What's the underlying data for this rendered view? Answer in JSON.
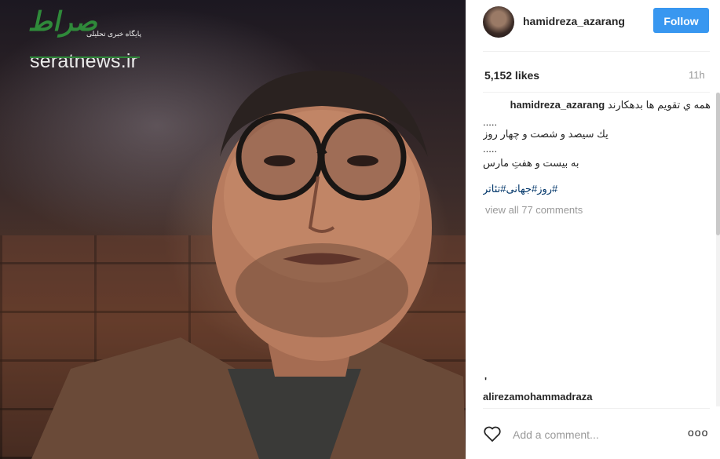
{
  "post": {
    "username": "hamidreza_azarang",
    "follow_label": "Follow",
    "likes": "5,152 likes",
    "time": "11h",
    "caption": {
      "line1": "همه ي تقويم ها بدهكارند",
      "dots1": ".....",
      "line2": "يك سيصد و شصت و چهار روز",
      "dots2": ".....",
      "line3": "به بيست و هفتِ مارس",
      "hashtags": "#روز#جهانی#تئاتر"
    },
    "view_all_comments": "view all 77 comments",
    "comment_peek_user": "alirezamohammadraza",
    "comment_peek_mark": "'",
    "comment_placeholder": "Add a comment...",
    "more_label": "ooo"
  },
  "watermark": {
    "script": "صراط",
    "tagline": "پایگاه خبری تحلیلی",
    "url": "seratnews.ir"
  },
  "icons": [
    "heart-icon",
    "more-options-icon"
  ],
  "colors": {
    "follow_blue": "#3897f0",
    "hashtag_blue": "#003569",
    "logo_green": "#2f8a3a"
  }
}
